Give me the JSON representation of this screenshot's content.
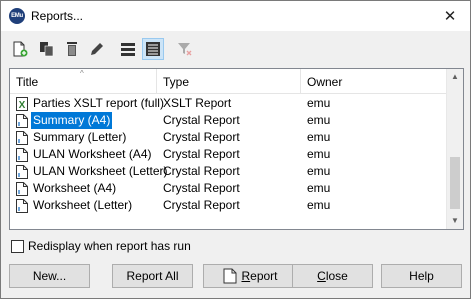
{
  "window": {
    "app_icon_text": "EMu",
    "title": "Reports..."
  },
  "toolbar": {
    "icons": [
      "new-report-icon",
      "copy-report-icon",
      "delete-icon",
      "edit-icon",
      "list-view-icon",
      "details-view-icon",
      "filter-icon"
    ]
  },
  "list": {
    "columns": [
      "Title",
      "Type",
      "Owner"
    ],
    "rows": [
      {
        "title": "Parties XSLT report (full)",
        "type": "XSLT Report",
        "owner": "emu",
        "icon": "xslt-icon"
      },
      {
        "title": "Summary (A4)",
        "type": "Crystal Report",
        "owner": "emu",
        "icon": "document-icon",
        "selected": true
      },
      {
        "title": "Summary (Letter)",
        "type": "Crystal Report",
        "owner": "emu",
        "icon": "document-icon"
      },
      {
        "title": "ULAN Worksheet (A4)",
        "type": "Crystal Report",
        "owner": "emu",
        "icon": "document-icon"
      },
      {
        "title": "ULAN Worksheet (Letter)",
        "type": "Crystal Report",
        "owner": "emu",
        "icon": "document-icon"
      },
      {
        "title": "Worksheet (A4)",
        "type": "Crystal Report",
        "owner": "emu",
        "icon": "document-icon"
      },
      {
        "title": "Worksheet (Letter)",
        "type": "Crystal Report",
        "owner": "emu",
        "icon": "document-icon"
      }
    ]
  },
  "options": {
    "redisplay_label": "Redisplay when report has run",
    "redisplay_checked": false
  },
  "buttons": {
    "new": "New...",
    "report_all": "Report All",
    "report_prefix": "",
    "report_underlined": "R",
    "report_rest": "eport",
    "close_underlined": "C",
    "close_rest": "lose",
    "help": "Help"
  },
  "colors": {
    "selection": "#0078d7",
    "toolbar_active": "#cce4f7"
  }
}
